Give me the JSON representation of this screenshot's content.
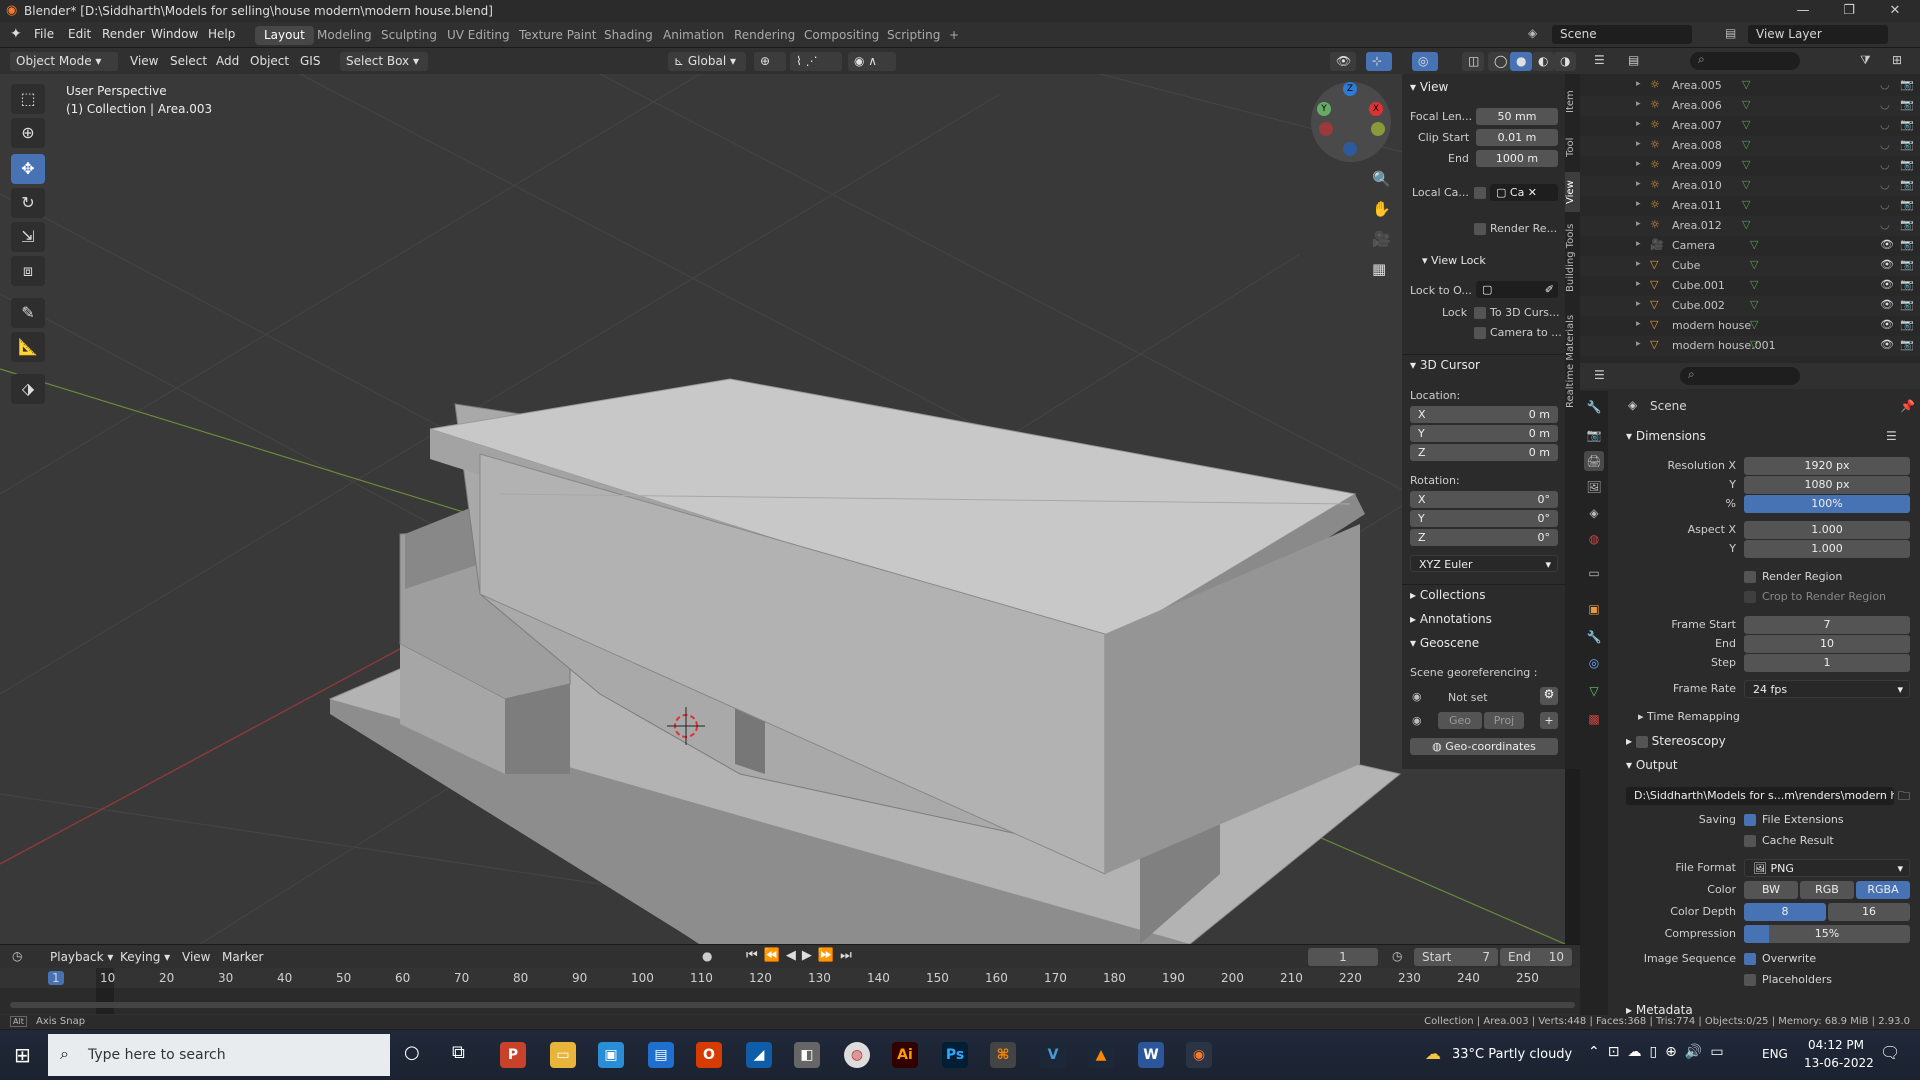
{
  "window": {
    "title": "Blender* [D:\\Siddharth\\Models for selling\\house modern\\modern house.blend]",
    "minimize": "—",
    "restore": "❐",
    "close": "✕"
  },
  "menus": [
    "File",
    "Edit",
    "Render",
    "Window",
    "Help"
  ],
  "workspaces": [
    "Layout",
    "Modeling",
    "Sculpting",
    "UV Editing",
    "Texture Paint",
    "Shading",
    "Animation",
    "Rendering",
    "Compositing",
    "Scripting",
    "+"
  ],
  "scene": {
    "label": "Scene",
    "view_layer": "View Layer"
  },
  "viewport_header": {
    "mode": "Object Mode",
    "view": "View",
    "select": "Select",
    "add": "Add",
    "object": "Object",
    "gis": "GIS",
    "select_box": "Select Box",
    "transform": "Global"
  },
  "viewport": {
    "perspective": "User Perspective",
    "collection": "(1) Collection | Area.003"
  },
  "gizmo": {
    "x": "X",
    "y": "Y",
    "z": "Z"
  },
  "npanel": {
    "tabs": [
      "Item",
      "Tool",
      "View",
      "Building Tools",
      "Realtime Materials"
    ],
    "view_header": "View",
    "focal_label": "Focal Len...",
    "focal_value": "50 mm",
    "clip_start_label": "Clip Start",
    "clip_start_value": "0.01 m",
    "end_label": "End",
    "end_value": "1000 m",
    "local_camera_label": "Local Ca...",
    "local_camera_value": "Ca",
    "render_region_label": "Render Re...",
    "view_lock_header": "View Lock",
    "lock_to_label": "Lock to O...",
    "lock_label": "Lock",
    "to_cursor": "To 3D Curs...",
    "camera_to": "Camera to ...",
    "cursor_header": "3D Cursor",
    "location_label": "Location:",
    "loc_x": "0 m",
    "loc_y": "0 m",
    "loc_z": "0 m",
    "rotation_label": "Rotation:",
    "rot_x": "0°",
    "rot_y": "0°",
    "rot_z": "0°",
    "rot_mode": "XYZ Euler",
    "collections": "Collections",
    "annotations": "Annotations",
    "geoscene": "Geoscene",
    "georef_label": "Scene georeferencing :",
    "not_set": "Not set",
    "geo": "Geo",
    "proj": "Proj",
    "geo_coords": "Geo-coordinates",
    "ax_x": "X",
    "ax_y": "Y",
    "ax_z": "Z"
  },
  "outliner": {
    "items": [
      {
        "name": "Area.005"
      },
      {
        "name": "Area.006"
      },
      {
        "name": "Area.007"
      },
      {
        "name": "Area.008"
      },
      {
        "name": "Area.009"
      },
      {
        "name": "Area.010"
      },
      {
        "name": "Area.011"
      },
      {
        "name": "Area.012"
      },
      {
        "name": "Camera"
      },
      {
        "name": "Cube"
      },
      {
        "name": "Cube.001"
      },
      {
        "name": "Cube.002"
      },
      {
        "name": "modern house"
      },
      {
        "name": "modern house.001"
      }
    ]
  },
  "properties": {
    "context": "Scene",
    "dimensions": "Dimensions",
    "res_x_label": "Resolution X",
    "res_x": "1920 px",
    "res_y_label": "Y",
    "res_y": "1080 px",
    "pct_label": "%",
    "pct": "100%",
    "aspect_x_label": "Aspect X",
    "aspect_x": "1.000",
    "aspect_y_label": "Y",
    "aspect_y": "1.000",
    "render_region": "Render Region",
    "crop": "Crop to Render Region",
    "frame_start_label": "Frame Start",
    "frame_start": "7",
    "end_label": "End",
    "end": "10",
    "step_label": "Step",
    "step": "1",
    "frame_rate_label": "Frame Rate",
    "frame_rate": "24 fps",
    "time_remap": "Time Remapping",
    "stereoscopy": "Stereoscopy",
    "output": "Output",
    "output_path": "D:\\Siddharth\\Models for s...m\\renders\\modern house",
    "saving_label": "Saving",
    "file_ext": "File Extensions",
    "cache": "Cache Result",
    "file_format_label": "File Format",
    "file_format": "PNG",
    "color_label": "Color",
    "bw": "BW",
    "rgb": "RGB",
    "rgba": "RGBA",
    "depth_label": "Color Depth",
    "d8": "8",
    "d16": "16",
    "compression_label": "Compression",
    "compression": "15%",
    "compression_value": 15,
    "image_seq_label": "Image Sequence",
    "overwrite": "Overwrite",
    "placeholders": "Placeholders",
    "metadata": "Metadata"
  },
  "timeline": {
    "playback": "Playback",
    "keying": "Keying",
    "view": "View",
    "marker": "Marker",
    "current": "1",
    "start_label": "Start",
    "start": "7",
    "end_label": "End",
    "end": "10",
    "ticks": [
      "1",
      "10",
      "20",
      "30",
      "40",
      "50",
      "60",
      "70",
      "80",
      "90",
      "100",
      "110",
      "120",
      "130",
      "140",
      "150",
      "160",
      "170",
      "180",
      "190",
      "200",
      "210",
      "220",
      "230",
      "240",
      "250"
    ]
  },
  "status": {
    "left": "Axis Snap",
    "right": "Collection | Area.003 | Verts:448 | Faces:368 | Tris:774 | Objects:0/25 | Memory: 68.9 MiB | 2.93.0"
  },
  "taskbar": {
    "search": "Type here to search",
    "weather": "33°C  Partly cloudy",
    "lang": "ENG",
    "time": "04:12 PM",
    "date": "13-06-2022"
  },
  "colors": {
    "accent": "#4772b3",
    "viewport": "#393939",
    "panel": "#2b2b2b"
  }
}
